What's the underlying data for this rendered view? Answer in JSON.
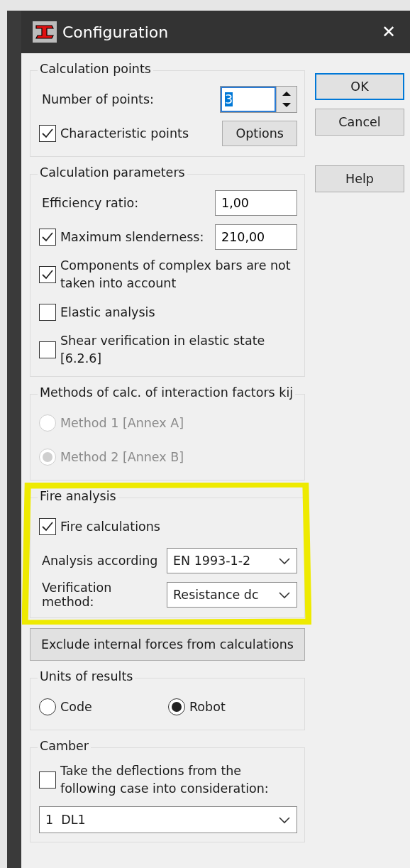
{
  "window": {
    "title": "Configuration",
    "close": "✕"
  },
  "sections": [
    {
      "kind": "group",
      "title": "Calculation points",
      "items": [
        {
          "kind": "spin",
          "label": "Number of points:",
          "value": "3"
        },
        {
          "kind": "checkbox",
          "label": "Characteristic points",
          "checked": true,
          "button": "Options"
        }
      ]
    },
    {
      "kind": "group",
      "title": "Calculation parameters",
      "items": [
        {
          "kind": "field",
          "label": "Efficiency ratio:",
          "value": "1,00"
        },
        {
          "kind": "checkbox",
          "label": "Maximum slenderness:",
          "checked": true,
          "value": "210,00"
        },
        {
          "kind": "checkbox",
          "label": "Components of complex bars are not taken into account",
          "checked": true
        },
        {
          "kind": "checkbox",
          "label": "Elastic analysis",
          "checked": false
        },
        {
          "kind": "checkbox",
          "label": "Shear verification in elastic state [6.2.6]",
          "checked": false
        }
      ]
    },
    {
      "kind": "group",
      "title": "Methods of calc. of interaction factors kij",
      "items": [
        {
          "kind": "radio",
          "label": "Method 1 [Annex A]",
          "selected": false,
          "disabled": true
        },
        {
          "kind": "radio",
          "label": "Method 2 [Annex B]",
          "selected": true,
          "disabled": true
        }
      ]
    },
    {
      "kind": "group",
      "title": "Fire analysis",
      "highlighted": true,
      "items": [
        {
          "kind": "checkbox",
          "label": "Fire calculations",
          "checked": true
        },
        {
          "kind": "select",
          "label": "Analysis according",
          "value": "EN 1993-1-2"
        },
        {
          "kind": "select",
          "label": "Verification method:",
          "value": "Resistance dc"
        }
      ]
    },
    {
      "kind": "button",
      "label": "Exclude internal forces from calculations"
    },
    {
      "kind": "group",
      "title": "Units of results",
      "items": [
        {
          "kind": "radio_row",
          "options": [
            {
              "label": "Code",
              "selected": false
            },
            {
              "label": "Robot",
              "selected": true
            }
          ]
        }
      ]
    },
    {
      "kind": "group",
      "title": "Camber",
      "items": [
        {
          "kind": "checkbox",
          "label": "Take the deflections from the following case into consideration:",
          "checked": false
        },
        {
          "kind": "wide_select",
          "value": "1  DL1"
        }
      ]
    }
  ],
  "buttons": [
    {
      "label": "OK",
      "default": true
    },
    {
      "label": "Cancel",
      "default": false
    },
    {
      "label": "Help",
      "default": false
    }
  ]
}
